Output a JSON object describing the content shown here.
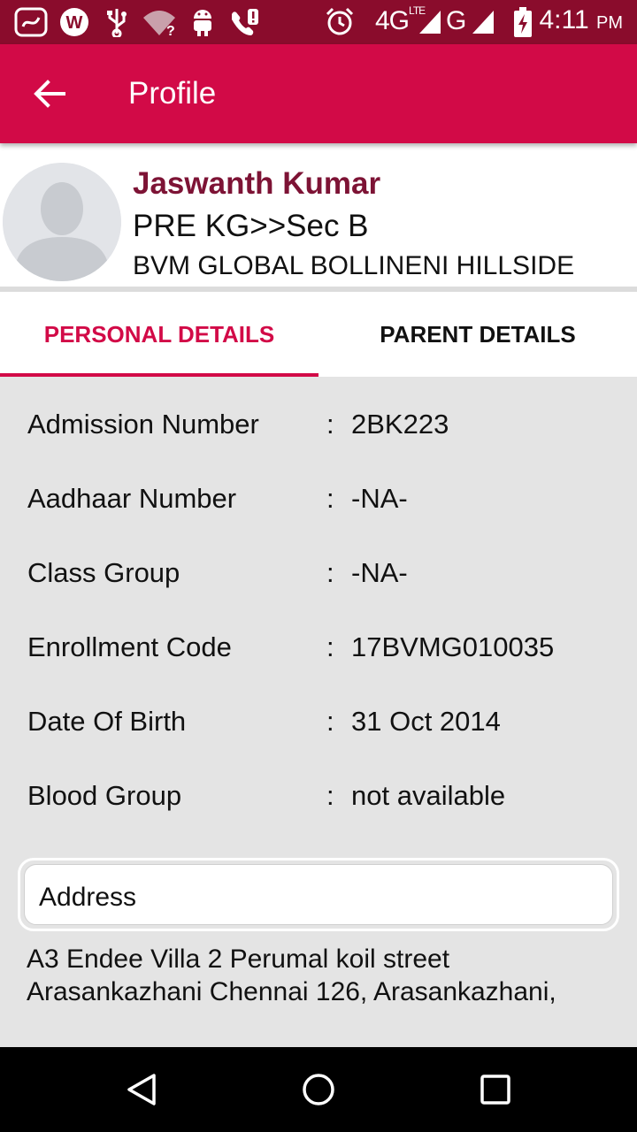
{
  "status_bar": {
    "network_text": "4G",
    "lte_text": "LTE",
    "network2_text": "G",
    "time": "4:11",
    "ampm": "PM",
    "icons": [
      "saavn-icon",
      "w-app-icon",
      "usb-icon",
      "wifi-unknown-icon",
      "android-icon",
      "missed-call-icon",
      "alarm-icon",
      "signal-icon",
      "battery-charging-icon"
    ]
  },
  "app_bar": {
    "title": "Profile",
    "back_icon": "arrow-back-icon"
  },
  "profile": {
    "name": "Jaswanth Kumar",
    "class": "PRE KG>>Sec B",
    "school": "BVM GLOBAL BOLLINENI HILLSIDE"
  },
  "tabs": {
    "personal": "PERSONAL DETAILS",
    "parent": "PARENT DETAILS",
    "selected": "PERSONAL DETAILS"
  },
  "details": [
    {
      "label": "Admission Number",
      "value": "2BK223"
    },
    {
      "label": "Aadhaar Number",
      "value": "-NA-"
    },
    {
      "label": "Class Group",
      "value": "-NA-"
    },
    {
      "label": "Enrollment Code",
      "value": "17BVMG010035"
    },
    {
      "label": "Date Of Birth",
      "value": "31 Oct 2014"
    },
    {
      "label": "Blood Group",
      "value": "not available"
    }
  ],
  "separator": ":",
  "address": {
    "label": "Address",
    "line1": "A3 Endee Villa 2 Perumal koil street",
    "line2": "Arasankazhani Chennai 126, Arasankazhani,"
  },
  "nav_bar": {
    "icons": [
      "back-triangle-icon",
      "home-circle-icon",
      "recents-square-icon"
    ]
  },
  "colors": {
    "primary": "#d20a47",
    "status_bar": "#8a0c2c",
    "name": "#7d1335",
    "background": "#e4e4e4"
  }
}
